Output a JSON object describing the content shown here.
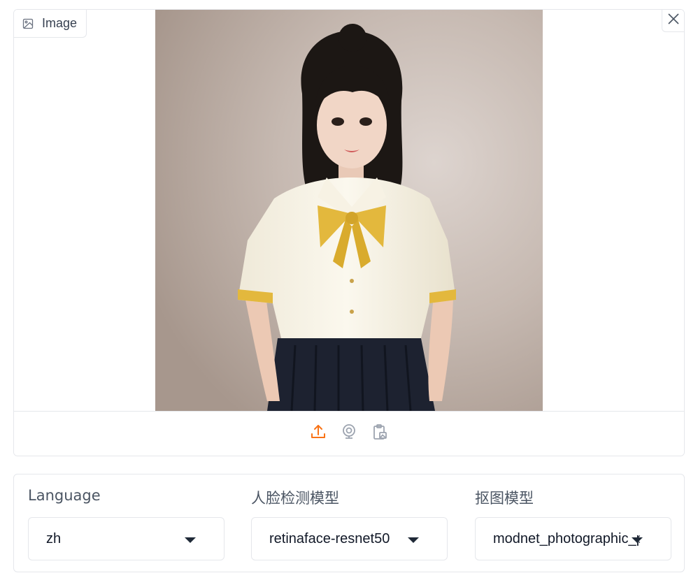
{
  "image_component": {
    "label": "Image",
    "label_icon": "image-icon",
    "close_icon": "close-icon",
    "toolbar": [
      {
        "name": "upload",
        "icon": "upload-icon",
        "color": "#f97316"
      },
      {
        "name": "webcam",
        "icon": "webcam-icon",
        "color": "#9ca3af"
      },
      {
        "name": "clipboard",
        "icon": "clipboard-icon",
        "color": "#9ca3af"
      }
    ]
  },
  "settings": {
    "language": {
      "label": "Language",
      "value": "zh"
    },
    "face_model": {
      "label": "人脸检测模型",
      "value": "retinaface-resnet50"
    },
    "matting_model": {
      "label": "抠图模型",
      "value": "modnet_photographic_portrait_matting"
    }
  },
  "colors": {
    "accent": "#f97316",
    "border": "#e5e7eb",
    "muted_icon": "#9ca3af"
  }
}
